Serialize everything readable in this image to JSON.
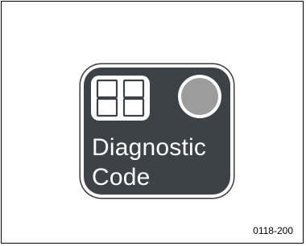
{
  "indicator": {
    "label_line1": "Diagnostic",
    "label_line2": "Code",
    "digit_display": "88",
    "led_color": "#9c9c9c",
    "badge_color": "#3d4247"
  },
  "figure": {
    "reference_number": "0118-200"
  }
}
